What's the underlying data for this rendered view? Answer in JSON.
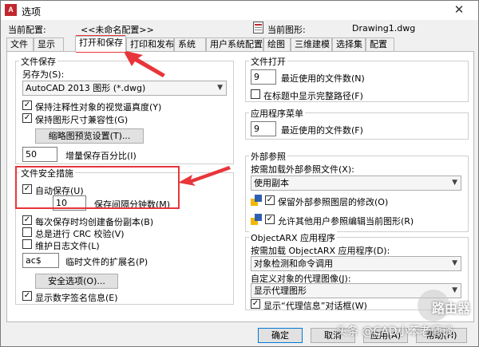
{
  "window": {
    "title": "选项",
    "close_glyph": "✕",
    "icon_text": "A"
  },
  "profile": {
    "current_profile_label": "当前配置:",
    "current_profile_value": "<<未命名配置>>",
    "current_drawing_label": "当前图形:",
    "current_drawing_value": "Drawing1.dwg"
  },
  "tabs": [
    {
      "label": "文件"
    },
    {
      "label": "显示"
    },
    {
      "label": "打开和保存"
    },
    {
      "label": "打印和发布"
    },
    {
      "label": "系统"
    },
    {
      "label": "用户系统配置"
    },
    {
      "label": "绘图"
    },
    {
      "label": "三维建模"
    },
    {
      "label": "选择集"
    },
    {
      "label": "配置"
    }
  ],
  "file_save": {
    "title": "文件保存",
    "save_as_label": "另存为(S):",
    "save_as_value": "AutoCAD 2013 图形 (*.dwg)",
    "maintain_visual_fidelity": "保持注释性对象的视觉逼真度(Y)",
    "maintain_drawing_size": "保持图形尺寸兼容性(G)",
    "thumbnail_settings": "缩略图预览设置(T)...",
    "incremental_value": "50",
    "incremental_label": "增量保存百分比(I)"
  },
  "file_safety": {
    "title": "文件安全措施",
    "autosave": "自动保存(U)",
    "minutes_value": "10",
    "minutes_label": "保存间隔分钟数(M)",
    "backup_copy": "每次保存时均创建备份副本(B)",
    "crc_check": "总是进行 CRC 校验(V)",
    "log_file": "维护日志文件(L)",
    "temp_ext_value": "ac$",
    "temp_ext_label": "临时文件的扩展名(P)",
    "security_options": "安全选项(O)...",
    "digital_signature": "显示数字签名信息(E)"
  },
  "file_open": {
    "title": "文件打开",
    "recent_value": "9",
    "recent_label": "最近使用的文件数(N)",
    "full_path": "在标题中显示完整路径(F)"
  },
  "app_menu": {
    "title": "应用程序菜单",
    "recent_value": "9",
    "recent_label": "最近使用的文件数(F)"
  },
  "xref": {
    "title": "外部参照",
    "demand_load_label": "按需加载外部参照文件(X):",
    "demand_load_value": "使用副本",
    "retain_layer_changes": "保留外部参照图层的修改(O)",
    "allow_edit": "允许其他用户参照编辑当前图形(R)"
  },
  "objectarx": {
    "title": "ObjectARX 应用程序",
    "demand_load_label": "按需加载 ObjectARX 应用程序(D):",
    "demand_load_value": "对象检测和命令调用",
    "proxy_images_label": "自定义对象的代理图像(J):",
    "proxy_images_value": "显示代理图形",
    "proxy_dialog": "显示“代理信息”对话框(W)"
  },
  "footer": {
    "ok": "确定",
    "cancel": "取消",
    "apply": "应用(A)",
    "help": "帮助(H)"
  },
  "watermark": {
    "text": "头条 @CAD小苯老师谈",
    "logo_text": "路由器"
  },
  "colors": {
    "accent_red": "#e8353b",
    "window_bg": "#f0f0f0"
  }
}
